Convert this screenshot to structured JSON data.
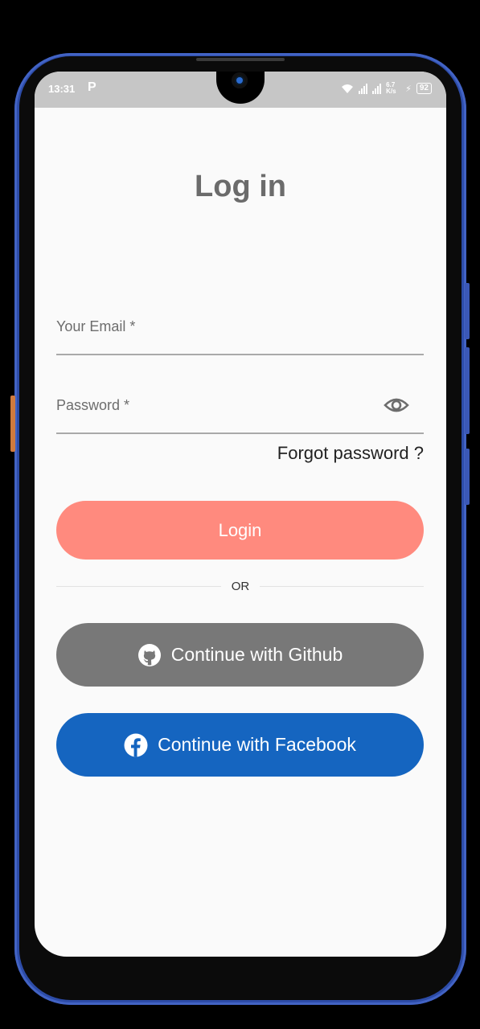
{
  "status_bar": {
    "time": "13:31",
    "app_badge": "P",
    "network_speed": "6.7 K/s",
    "battery": "92"
  },
  "page": {
    "title": "Log in"
  },
  "form": {
    "email_label": "Your Email *",
    "password_label": "Password *",
    "forgot_password": "Forgot password ?",
    "login_button": "Login",
    "divider": "OR"
  },
  "social": {
    "github_label": "Continue with Github",
    "facebook_label": "Continue with Facebook"
  },
  "colors": {
    "login_button": "#ff8a7e",
    "github_button": "#787878",
    "facebook_button": "#1565c0",
    "frame": "#2d4ca8"
  },
  "icons": {
    "github": "github-icon",
    "facebook": "facebook-icon",
    "password_toggle": "eye-icon"
  }
}
